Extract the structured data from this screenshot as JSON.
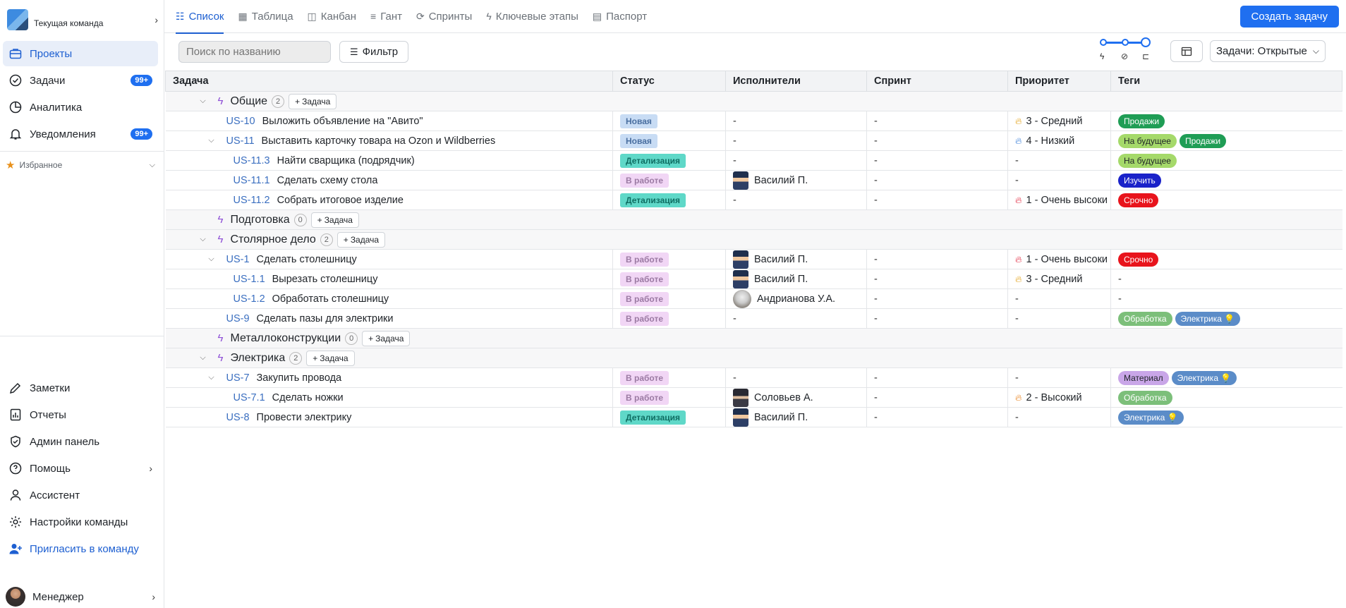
{
  "sidebar": {
    "team_name": "Текущая команда",
    "nav": [
      {
        "label": "Проекты",
        "icon": "briefcase-icon",
        "active": true
      },
      {
        "label": "Задачи",
        "icon": "check-circle-icon",
        "badge": "99+"
      },
      {
        "label": "Аналитика",
        "icon": "pie-chart-icon"
      },
      {
        "label": "Уведомления",
        "icon": "bell-icon",
        "badge": "99+"
      }
    ],
    "favorites_label": "Избранное",
    "bottom": [
      {
        "label": "Заметки",
        "icon": "pen-icon"
      },
      {
        "label": "Отчеты",
        "icon": "report-icon"
      },
      {
        "label": "Админ панель",
        "icon": "shield-icon"
      },
      {
        "label": "Помощь",
        "icon": "help-icon"
      },
      {
        "label": "Ассистент",
        "icon": "person-icon"
      },
      {
        "label": "Настройки команды",
        "icon": "gear-icon"
      },
      {
        "label": "Пригласить в команду",
        "icon": "add-user-icon"
      }
    ],
    "user_name": "Менеджер"
  },
  "tabs": [
    {
      "label": "Список",
      "active": true
    },
    {
      "label": "Таблица"
    },
    {
      "label": "Канбан"
    },
    {
      "label": "Гант"
    },
    {
      "label": "Спринты"
    },
    {
      "label": "Ключевые этапы"
    },
    {
      "label": "Паспорт"
    }
  ],
  "create_button": "Создать задачу",
  "search_placeholder": "Поиск по названию",
  "filter_label": "Фильтр",
  "tasks_dropdown": "Задачи: Открытые",
  "columns": [
    "Задача",
    "Статус",
    "Исполнители",
    "Спринт",
    "Приоритет",
    "Теги"
  ],
  "add_task_label": "Задача",
  "groups": [
    {
      "name": "Общие",
      "count": "2",
      "rows": [
        {
          "id": "US-10",
          "title": "Выложить объявление на \"Авито\"",
          "indent": 1,
          "status": "Новая",
          "st": "new",
          "assignee": "-",
          "sprint": "-",
          "priority": "3 - Средний",
          "flame": "#e3a21a",
          "tags": [
            {
              "t": "Продажи",
              "bg": "#1f9d55",
              "fg": "#fff"
            }
          ]
        },
        {
          "id": "US-11",
          "title": "Выставить карточку товара на Ozon и Wildberries",
          "indent": 1,
          "expand": true,
          "status": "Новая",
          "st": "new",
          "assignee": "-",
          "sprint": "-",
          "priority": "4 - Низкий",
          "flame": "#3b7fd8",
          "tags": [
            {
              "t": "На будущее",
              "bg": "#a5d96a",
              "fg": "#1f2328"
            },
            {
              "t": "Продажи",
              "bg": "#1f9d55",
              "fg": "#fff"
            }
          ]
        },
        {
          "id": "US-11.3",
          "title": "Найти сварщика (подрядчик)",
          "indent": 2,
          "status": "Детализация",
          "st": "det",
          "assignee": "-",
          "sprint": "-",
          "priority": "-",
          "tags": [
            {
              "t": "На будущее",
              "bg": "#a5d96a",
              "fg": "#1f2328"
            }
          ]
        },
        {
          "id": "US-11.1",
          "title": "Сделать схему стола",
          "indent": 2,
          "status": "В работе",
          "st": "work",
          "assignee": "Василий П.",
          "ava": "v",
          "sprint": "-",
          "priority": "-",
          "tags": [
            {
              "t": "Изучить",
              "bg": "#1a22c9",
              "fg": "#fff"
            }
          ]
        },
        {
          "id": "US-11.2",
          "title": "Собрать итоговое изделие",
          "indent": 2,
          "status": "Детализация",
          "st": "det",
          "assignee": "-",
          "sprint": "-",
          "priority": "1 - Очень высоки",
          "flame": "#e0243c",
          "tags": [
            {
              "t": "Срочно",
              "bg": "#e8141c",
              "fg": "#fff"
            }
          ]
        }
      ]
    },
    {
      "name": "Подготовка",
      "count": "0",
      "rows": []
    },
    {
      "name": "Столярное дело",
      "count": "2",
      "rows": [
        {
          "id": "US-1",
          "title": "Сделать столешницу",
          "indent": 1,
          "expand": true,
          "status": "В работе",
          "st": "work",
          "assignee": "Василий П.",
          "ava": "v",
          "sprint": "-",
          "priority": "1 - Очень высоки",
          "flame": "#e0243c",
          "tags": [
            {
              "t": "Срочно",
              "bg": "#e8141c",
              "fg": "#fff"
            }
          ]
        },
        {
          "id": "US-1.1",
          "title": "Вырезать столешницу",
          "indent": 2,
          "status": "В работе",
          "st": "work",
          "assignee": "Василий П.",
          "ava": "v",
          "sprint": "-",
          "priority": "3 - Средний",
          "flame": "#e3a21a",
          "tags": []
        },
        {
          "id": "US-1.2",
          "title": "Обработать столешницу",
          "indent": 2,
          "status": "В работе",
          "st": "work",
          "assignee": "Андрианова У.А.",
          "ava": "a",
          "sprint": "-",
          "priority": "-",
          "tags": []
        },
        {
          "id": "US-9",
          "title": "Сделать пазы для электрики",
          "indent": 1,
          "status": "В работе",
          "st": "work",
          "assignee": "-",
          "sprint": "-",
          "priority": "-",
          "tags": [
            {
              "t": "Обработка",
              "bg": "#7cbf7a",
              "fg": "#fff"
            },
            {
              "t": "Электрика 💡",
              "bg": "#5b8cc8",
              "fg": "#fff"
            }
          ]
        }
      ]
    },
    {
      "name": "Металлоконструкции",
      "count": "0",
      "rows": []
    },
    {
      "name": "Электрика",
      "count": "2",
      "rows": [
        {
          "id": "US-7",
          "title": "Закупить провода",
          "indent": 1,
          "expand": true,
          "status": "В работе",
          "st": "work",
          "assignee": "-",
          "sprint": "-",
          "priority": "-",
          "tags": [
            {
              "t": "Материал",
              "bg": "#c9a6e8",
              "fg": "#1f2328"
            },
            {
              "t": "Электрика 💡",
              "bg": "#5b8cc8",
              "fg": "#fff"
            }
          ]
        },
        {
          "id": "US-7.1",
          "title": "Сделать ножки",
          "indent": 2,
          "status": "В работе",
          "st": "work",
          "assignee": "Соловьев А.",
          "ava": "s",
          "sprint": "-",
          "priority": "2 - Высокий",
          "flame": "#e8801a",
          "tags": [
            {
              "t": "Обработка",
              "bg": "#7cbf7a",
              "fg": "#fff"
            }
          ]
        },
        {
          "id": "US-8",
          "title": "Провести электрику",
          "indent": 1,
          "status": "Детализация",
          "st": "det",
          "assignee": "Василий П.",
          "ava": "v",
          "sprint": "-",
          "priority": "-",
          "tags": [
            {
              "t": "Электрика 💡",
              "bg": "#5b8cc8",
              "fg": "#fff"
            }
          ]
        }
      ]
    }
  ]
}
